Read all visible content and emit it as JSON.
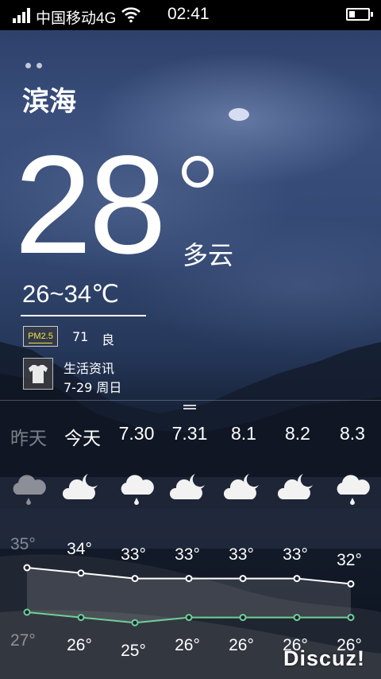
{
  "status_bar": {
    "carrier": "中国移动4G",
    "time": "02:41"
  },
  "weather": {
    "city": "滨海",
    "current_temp": "28",
    "condition": "多云",
    "range": "26~34℃",
    "pm25_label": "PM2.5",
    "pm25_value": "71",
    "pm25_level": "良",
    "life_title": "生活资讯",
    "life_date": "7-29 周日"
  },
  "forecast": {
    "days": [
      "昨天",
      "今天",
      "7.30",
      "7.31",
      "8.1",
      "8.2",
      "8.3"
    ],
    "icons": [
      "cloud-rain-icon",
      "cloud-moon-icon",
      "cloud-rain-icon",
      "cloud-moon-icon",
      "cloud-moon-icon",
      "cloud-moon-icon",
      "cloud-rain-icon"
    ],
    "axis_high": "35°",
    "axis_low": "27°"
  },
  "chart_data": {
    "type": "line",
    "categories": [
      "昨天",
      "今天",
      "7.30",
      "7.31",
      "8.1",
      "8.2",
      "8.3"
    ],
    "series": [
      {
        "values": [
          35,
          34,
          33,
          33,
          33,
          33,
          32
        ]
      },
      {
        "values": [
          27,
          26,
          25,
          26,
          26,
          26,
          26
        ]
      }
    ],
    "high_labels": [
      "34°",
      "33°",
      "33°",
      "33°",
      "33°",
      "32°"
    ],
    "low_labels": [
      "26°",
      "25°",
      "26°",
      "26°",
      "26°",
      "26°"
    ],
    "colors": {
      "high": "#ffffff",
      "low": "#6fcf97"
    }
  },
  "watermark": "Discuz!"
}
